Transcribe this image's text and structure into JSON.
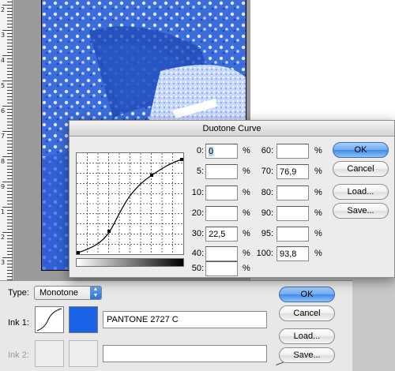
{
  "ruler_labels": [
    "2",
    "3",
    "4",
    "5",
    "6",
    "7",
    "8",
    "9",
    "1",
    "2",
    "3"
  ],
  "curve_dialog": {
    "title": "Duotone Curve",
    "fields_left": [
      {
        "label": "0:",
        "value": "0",
        "unit": "%"
      },
      {
        "label": "5:",
        "value": "",
        "unit": "%"
      },
      {
        "label": "10:",
        "value": "",
        "unit": "%"
      },
      {
        "label": "20:",
        "value": "",
        "unit": "%"
      },
      {
        "label": "30:",
        "value": "22,5",
        "unit": "%"
      },
      {
        "label": "40:",
        "value": "",
        "unit": "%"
      },
      {
        "label": "50:",
        "value": "",
        "unit": "%"
      }
    ],
    "fields_right": [
      {
        "label": "60:",
        "value": "",
        "unit": "%"
      },
      {
        "label": "70:",
        "value": "76,9",
        "unit": "%"
      },
      {
        "label": "80:",
        "value": "",
        "unit": "%"
      },
      {
        "label": "90:",
        "value": "",
        "unit": "%"
      },
      {
        "label": "95:",
        "value": "",
        "unit": "%"
      },
      {
        "label": "100:",
        "value": "93,8",
        "unit": "%"
      }
    ],
    "buttons": {
      "ok": "OK",
      "cancel": "Cancel",
      "load": "Load...",
      "save": "Save..."
    }
  },
  "options_panel": {
    "type_label": "Type:",
    "type_value": "Monotone",
    "ink1_label": "Ink 1:",
    "ink1_name": "PANTONE 2727 C",
    "ink1_color": "#1a63e6",
    "ink2_label": "Ink 2:",
    "ink2_name": "",
    "buttons": {
      "ok": "OK",
      "cancel": "Cancel",
      "load": "Load...",
      "save": "Save..."
    }
  }
}
